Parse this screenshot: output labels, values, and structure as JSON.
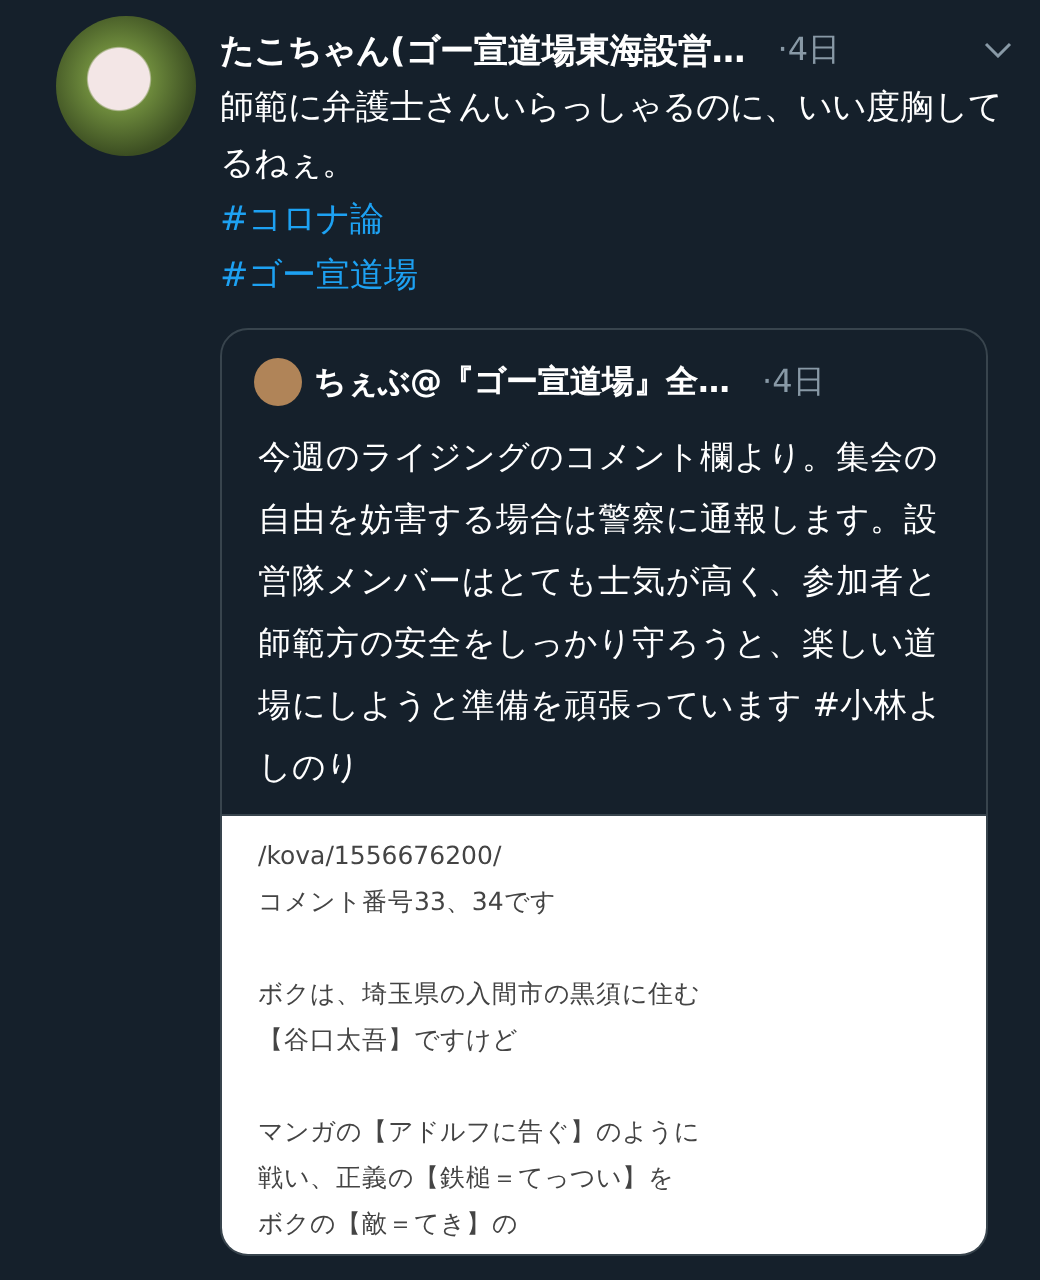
{
  "tweet": {
    "name": "たこちゃん(ゴー宣道場東海設営…",
    "time": "·4日",
    "text": "師範に弁護士さんいらっしゃるのに、いい度胸してるねぇ。",
    "hashtags": [
      "#コロナ論",
      "#ゴー宣道場"
    ],
    "quote": {
      "name": "ちぇぶ@『ゴー宣道場』全…",
      "time": "·4日",
      "text": "今週のライジングのコメント欄より。集会の自由を妨害する場合は警察に通報します。設営隊メンバーはとても士気が高く、参加者と師範方の安全をしっかり守ろうと、楽しい道場にしようと準備を頑張っています #小林よしのり",
      "image_paragraphs": [
        [
          "/kova/1556676200/",
          "コメント番号33、34です"
        ],
        [
          "ボクは、埼玉県の入間市の黒須に住む",
          "【谷口太吾】ですけど"
        ],
        [
          "マンガの【アドルフに告ぐ】のように",
          "戦い、正義の【鉄槌＝てっつい】を",
          "ボクの【敵＝てき】の"
        ]
      ]
    }
  }
}
